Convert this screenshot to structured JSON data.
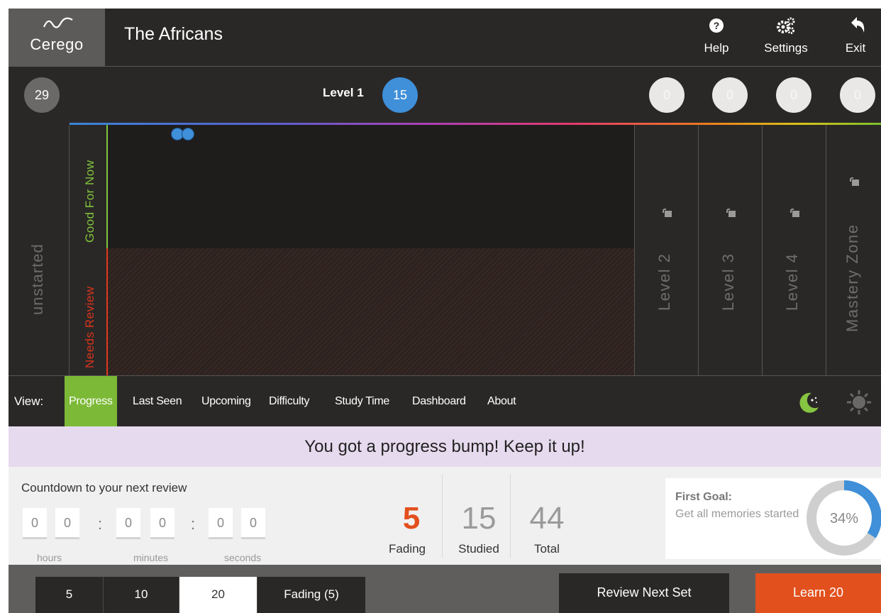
{
  "app": {
    "logo_text": "Cerego",
    "title": "The Africans"
  },
  "header": {
    "help_label": "Help",
    "settings_label": "Settings",
    "exit_label": "Exit",
    "icons": [
      "help-icon",
      "settings-icon",
      "exit-icon"
    ]
  },
  "levels": {
    "unstarted_count": "29",
    "level1_label": "Level 1",
    "level1_count": "15",
    "level2_count": "0",
    "level3_count": "0",
    "level4_count": "0",
    "mastery_count": "0"
  },
  "columns": {
    "unstarted": "unstarted",
    "good_for_now": "Good For Now",
    "needs_review": "Needs Review",
    "level2": "Level 2",
    "level3": "Level 3",
    "level4": "Level 4",
    "mastery": "Mastery Zone"
  },
  "view": {
    "label": "View:",
    "tabs": [
      "Progress",
      "Last Seen",
      "Upcoming",
      "Difficulty",
      "Study Time",
      "Dashboard",
      "About"
    ],
    "active_tab": "Progress"
  },
  "message": "You got a progress bump! Keep it up!",
  "countdown": {
    "label": "Countdown to your next review",
    "digits": [
      "0",
      "0",
      "0",
      "0",
      "0",
      "0"
    ],
    "units": [
      "hours",
      "minutes",
      "seconds"
    ]
  },
  "stats": {
    "fading_value": "5",
    "fading_label": "Fading",
    "studied_value": "15",
    "studied_label": "Studied",
    "total_value": "44",
    "total_label": "Total"
  },
  "goal": {
    "title": "First Goal:",
    "description": "Get all memories started",
    "percent_label": "34%",
    "percent": 34
  },
  "bottom": {
    "set_sizes": [
      "5",
      "10",
      "20",
      "Fading (5)"
    ],
    "selected": "20",
    "review_label": "Review Next Set",
    "learn_label": "Learn 20"
  },
  "colors": {
    "accent_green": "#7cb936",
    "accent_orange": "#e2501d",
    "accent_blue": "#3f8fd9",
    "dark_bg": "#2a2827"
  }
}
